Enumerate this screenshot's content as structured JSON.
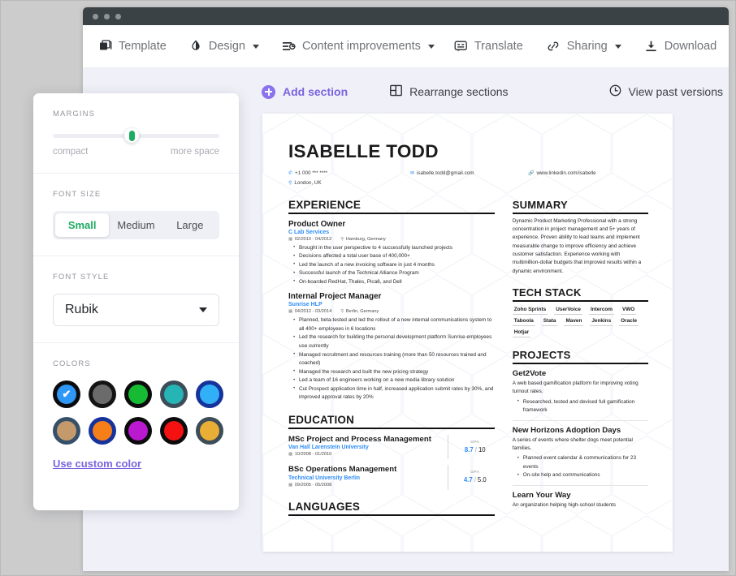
{
  "window": {
    "dots": 3
  },
  "toolbar": {
    "items": [
      {
        "label": "Template",
        "icon": "template-icon",
        "caret": false
      },
      {
        "label": "Design",
        "icon": "contrast-icon",
        "caret": true
      },
      {
        "label": "Content improvements",
        "icon": "content-improvements-icon",
        "caret": true
      }
    ],
    "right_items": [
      {
        "label": "Translate",
        "icon": "translate-icon",
        "caret": false
      },
      {
        "label": "Sharing",
        "icon": "link-icon",
        "caret": true
      },
      {
        "label": "Download",
        "icon": "download-icon",
        "caret": false
      }
    ]
  },
  "section_bar": {
    "add_section": "Add section",
    "rearrange": "Rearrange sections",
    "past_versions": "View past versions"
  },
  "panel": {
    "margins": {
      "label": "MARGINS",
      "left_end": "compact",
      "right_end": "more space",
      "value_percent": 42
    },
    "font_size": {
      "label": "FONT SIZE",
      "options": [
        "Small",
        "Medium",
        "Large"
      ],
      "selected": "Small"
    },
    "font_style": {
      "label": "FONT STYLE",
      "selected": "Rubik"
    },
    "colors": {
      "label": "COLORS",
      "custom_link": "Use custom color",
      "selected_index": 0,
      "swatches": [
        {
          "ring": "#0b0b0d",
          "fill": "#2f97f5"
        },
        {
          "ring": "#141414",
          "fill": "#6b6b6b"
        },
        {
          "ring": "#0c0c0c",
          "fill": "#16ba33"
        },
        {
          "ring": "#3c4c58",
          "fill": "#27b4b4"
        },
        {
          "ring": "#16339c",
          "fill": "#32b0f7"
        },
        {
          "ring": "#36506a",
          "fill": "#c49a6c"
        },
        {
          "ring": "#16339c",
          "fill": "#f77f1a"
        },
        {
          "ring": "#0b0b0b",
          "fill": "#bb19cf"
        },
        {
          "ring": "#0b0b0b",
          "fill": "#f31111"
        },
        {
          "ring": "#3c4c58",
          "fill": "#e8ae35"
        }
      ]
    }
  },
  "resume": {
    "name": "ISABELLE TODD",
    "contacts": [
      {
        "icon": "phone-icon",
        "text": "+1 000 *** ****"
      },
      {
        "icon": "location-icon",
        "text": "London, UK"
      },
      {
        "icon": "email-icon",
        "text": "isabelle.todd@gmail.com"
      },
      {
        "icon": "linkedin-icon",
        "text": "www.linkedin.com/isabelle"
      }
    ],
    "experience": {
      "heading": "EXPERIENCE",
      "jobs": [
        {
          "title": "Product Owner",
          "org": "C Lab Services",
          "dates": "02/2010 - 04/2012",
          "location": "Hamburg, Germany",
          "bullets": [
            "Brought in the user perspective to 4 successfully launched projects",
            "Decisions affected a total user base of 400,000+",
            "Led the launch of a new invoicing software in just 4 months",
            "Successful launch of the Technical Alliance Program",
            "On-boarded RedHat, Thales, Pica8, and Dell"
          ]
        },
        {
          "title": "Internal Project Manager",
          "org": "Sunrise HLP",
          "dates": "04/2012 - 03/2014",
          "location": "Berlin, Germany",
          "bullets": [
            "Planned, beta-tested and led the rollout of a new internal communications system to all 400+ employees in 6 locations",
            "Led the research for building the personal development platform Sunrise employees use currently",
            "Managed recruitment and resources training (more than 50 resources trained and coached)",
            "Managed the research and built the new pricing strategy",
            "Led a team of 16 engineers working on a new media library solution",
            "Cut Prospect application time in half, increased application submit rates by 30%, and improved approval rates by 20%"
          ]
        }
      ]
    },
    "education": {
      "heading": "EDUCATION",
      "entries": [
        {
          "degree": "MSc Project and Process Management",
          "school": "Van Hall Larenstein University",
          "dates": "10/2008 - 01/2010",
          "gpa_label": "GPA",
          "gpa_value": "8.7",
          "gpa_scale": "10"
        },
        {
          "degree": "BSc Operations Management",
          "school": "Technical University Berlin",
          "dates": "09/2005 - 05/2008",
          "gpa_label": "GPA",
          "gpa_value": "4.7",
          "gpa_scale": "5.0"
        }
      ]
    },
    "languages": {
      "heading": "LANGUAGES"
    },
    "summary": {
      "heading": "SUMMARY",
      "text": "Dynamic Product Marketing Professional with a strong concentration in project management and 5+ years of experience. Proven ability to lead teams and implement measurable change to improve efficiency and achieve customer satisfaction. Experience working with multimillion-dollar budgets that improved results within a dynamic environment."
    },
    "tech_stack": {
      "heading": "TECH STACK",
      "items": [
        "Zoho Sprints",
        "UserVoice",
        "Intercom",
        "VWO",
        "Taboola",
        "Stata",
        "Maven",
        "Jenkins",
        "Oracle",
        "Hotjar"
      ]
    },
    "projects": {
      "heading": "PROJECTS",
      "items": [
        {
          "title": "Get2Vote",
          "description": "A web based gamification platform for improving voting turnout rates.",
          "bullets": [
            "Researched, tested and devised full gamification framework"
          ]
        },
        {
          "title": "New Horizons Adoption Days",
          "description": "A series of events where shelter dogs meet potential families.",
          "bullets": [
            "Planned event calendar & communications for 23 events",
            "On-site help and communications"
          ]
        },
        {
          "title": "Learn Your Way",
          "description": "An organization helping high-school students",
          "bullets": []
        }
      ]
    }
  }
}
